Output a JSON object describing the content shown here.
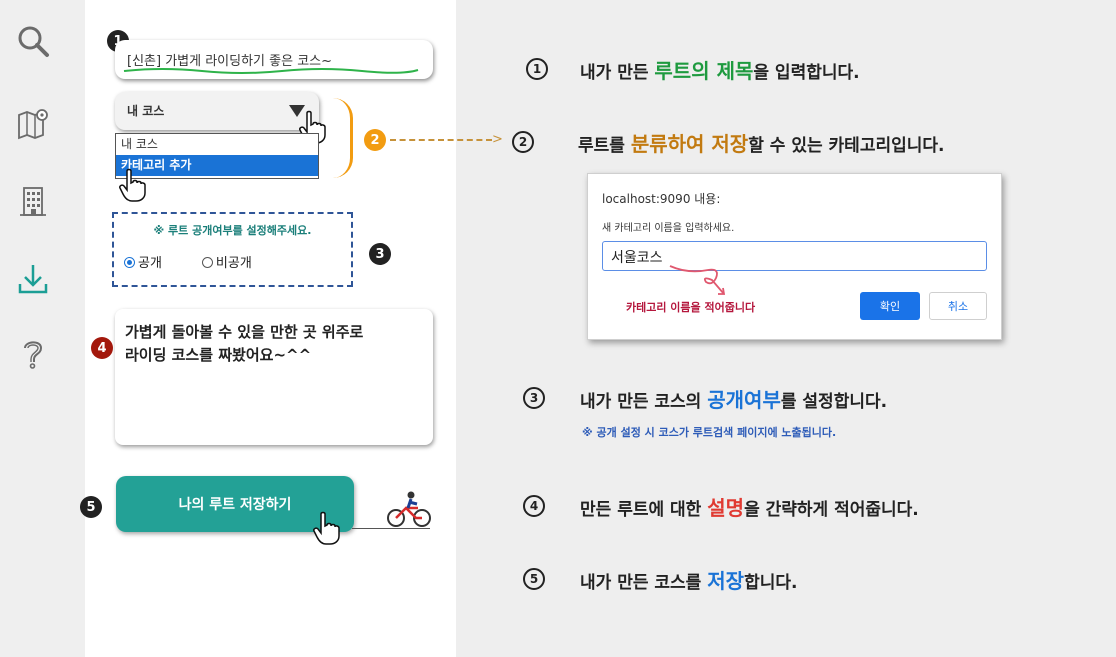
{
  "sidebar": {
    "icons": [
      {
        "name": "search-icon"
      },
      {
        "name": "map-icon"
      },
      {
        "name": "building-icon"
      },
      {
        "name": "download-icon"
      },
      {
        "name": "help-icon"
      }
    ]
  },
  "form": {
    "badges": {
      "title": "1",
      "category": "2",
      "visibility": "3",
      "description": "4",
      "save": "5"
    },
    "title_value": "[신촌] 가볍게 라이딩하기 좋은 코스~",
    "category_selected": "내 코스",
    "category_options": [
      "내 코스",
      "카테고리 추가"
    ],
    "visibility_title": "※ 루트 공개여부를 설정해주세요.",
    "visibility_options": {
      "public": "공개",
      "private": "비공개"
    },
    "visibility_selected": "public",
    "description_lines": [
      "가볍게 돌아볼 수 있을 만한 곳 위주로",
      "라이딩 코스를 짜봤어요~^^"
    ],
    "save_button": "나의 루트 저장하기"
  },
  "steps": {
    "s1": {
      "num": "1",
      "pre": "내가 만든 ",
      "hl": "루트의 제목",
      "post": "을 입력합니다."
    },
    "s2": {
      "num": "2",
      "pre": "루트를 ",
      "hl": "분류하여 저장",
      "post": "할 수 있는 카테고리입니다."
    },
    "s3": {
      "num": "3",
      "pre": "내가 만든 코스의 ",
      "hl": "공개여부",
      "post": "를 설정합니다.",
      "note": "※ 공개 설정 시 코스가 루트검색 페이지에 노출됩니다."
    },
    "s4": {
      "num": "4",
      "pre": "만든 루트에 대한 ",
      "hl": "설명",
      "post": "을 간략하게 적어줍니다."
    },
    "s5": {
      "num": "5",
      "pre": "내가 만든 코스를 ",
      "hl": "저장",
      "post": "합니다."
    }
  },
  "dialog": {
    "origin": "localhost:9090 내용:",
    "message": "새 카테고리 이름을 입력하세요.",
    "input_value": "서울코스",
    "hint": "카테고리 이름을 적어줍니다",
    "ok": "확인",
    "cancel": "취소"
  },
  "colors": {
    "teal": "#23a196",
    "orange": "#f29c11",
    "green": "#1e9a3f",
    "blue": "#1a73d6",
    "red": "#e03a32"
  }
}
